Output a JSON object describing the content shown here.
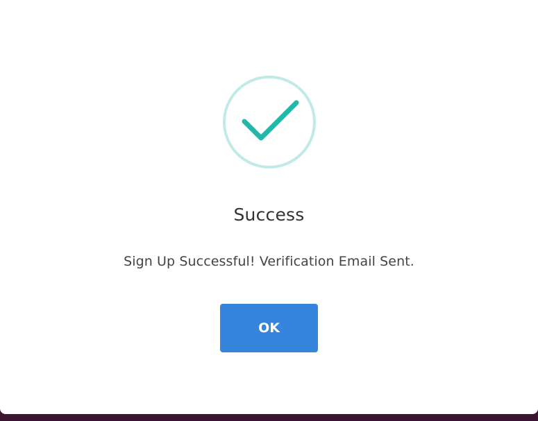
{
  "dialog": {
    "icon": "checkmark-success-icon",
    "title": "Success",
    "message": "Sign Up Successful! Verification Email Sent.",
    "ok_label": "OK"
  },
  "colors": {
    "accent_ring": "#bfeae7",
    "check": "#1fb8a9",
    "button": "#3585dc",
    "backdrop": "#4b1a3a"
  }
}
